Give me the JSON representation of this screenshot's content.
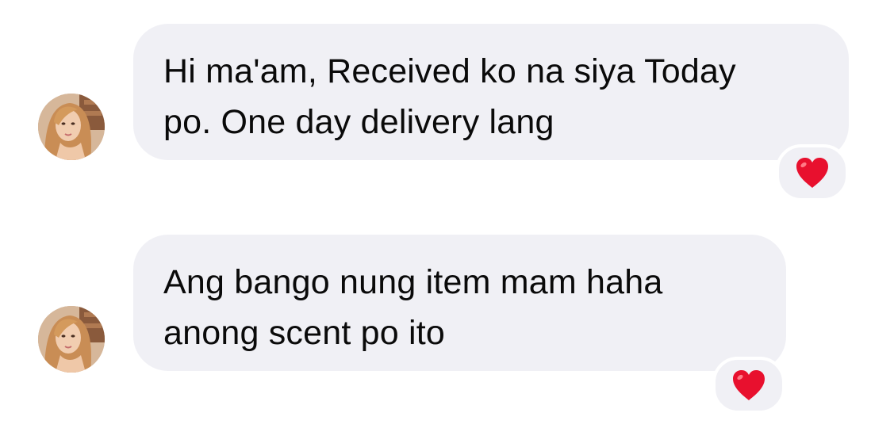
{
  "messages": [
    {
      "sender": "avatar",
      "text": "Hi ma'am, Received ko na siya Today\npo. One day delivery lang",
      "reaction": "red-heart-icon"
    },
    {
      "sender": "avatar",
      "text": "Ang bango nung item mam haha\nanong scent po ito",
      "reaction": "red-heart-icon"
    }
  ],
  "colors": {
    "bubble_background": "#f0f0f5",
    "text": "#0a0a0a",
    "reaction_heart": "#e8102e",
    "page_background": "#ffffff"
  }
}
